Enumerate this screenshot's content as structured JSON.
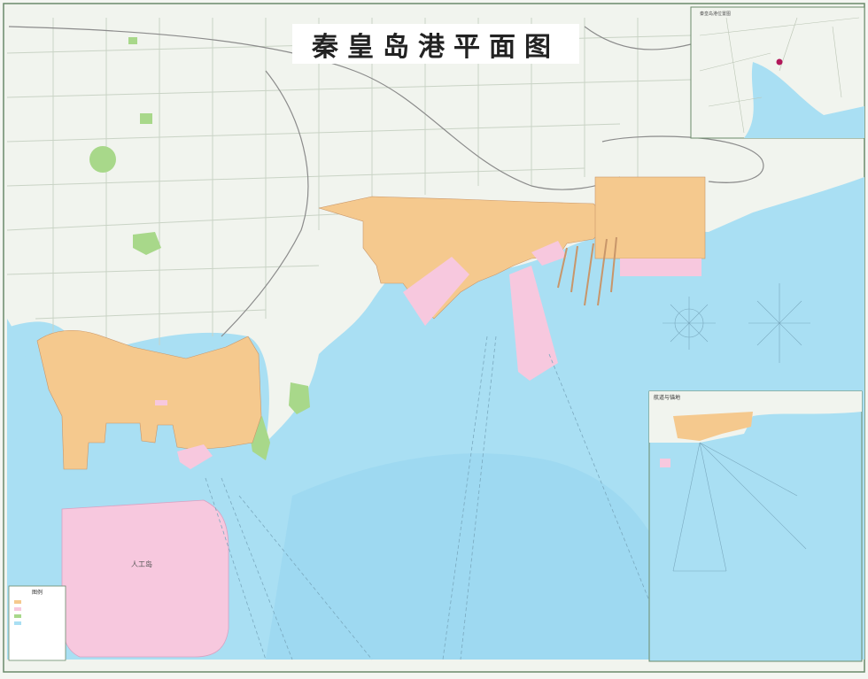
{
  "map": {
    "title": "秦皇岛港平面图",
    "location_inset": {
      "label": "秦皇岛港位置图"
    },
    "port_detail_inset": {
      "label": "航道与锚地"
    },
    "artificial_island": {
      "label": "人工岛"
    },
    "legend": {
      "title": "图例"
    },
    "colors": {
      "sea": "#a9dff3",
      "sea_deep": "#8fd2ef",
      "land": "#f1f4ee",
      "port_area": "#f5c98e",
      "reclaimed_area": "#f7c8de",
      "green_space": "#a8d88a",
      "roads": "#c9d3c5",
      "rail": "#8b8b8b"
    }
  }
}
